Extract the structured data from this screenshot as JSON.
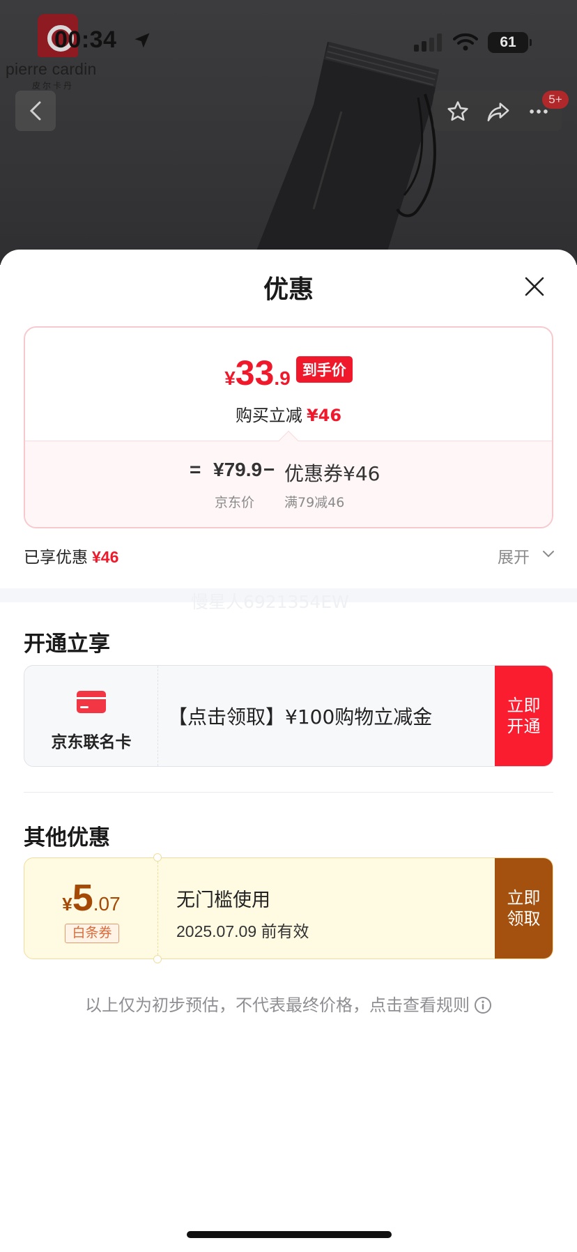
{
  "status_bar": {
    "time": "00:34",
    "battery": "61"
  },
  "brand": {
    "name": "pierre cardin",
    "subtitle": "皮尔卡丹"
  },
  "topbar": {
    "badge": "5+"
  },
  "sheet": {
    "title": "优惠",
    "price_card": {
      "currency": "¥",
      "price_int": "33",
      "price_dec": ".9",
      "price_tag": "到手价",
      "discount_label": "购买立减",
      "discount_value": "¥46",
      "eq": "=",
      "jd_price": "¥79.9",
      "minus": "−",
      "coupon": "优惠券¥46",
      "jd_price_label": "京东价",
      "coupon_rule": "满79减46"
    },
    "enjoyed_label": "已享优惠",
    "enjoyed_value": "¥46",
    "expand_label": "展开",
    "watermark": "慢星人6921354EW",
    "section_open": "开通立享",
    "jd_card": {
      "name": "京东联名卡",
      "desc": "【点击领取】¥100购物立减金",
      "cta": "立即开通"
    },
    "section_other": "其他优惠",
    "baitiao": {
      "currency": "¥",
      "amount_int": "5",
      "amount_dec": ".07",
      "tag": "白条券",
      "title": "无门槛使用",
      "validity": "2025.07.09 前有效",
      "cta": "立即领取"
    },
    "disclaimer": "以上仅为初步预估，不代表最终价格，点击查看规则"
  },
  "colors": {
    "accent_red": "#f0182b",
    "cta_red": "#fa1d30",
    "baitiao_brown": "#a4500e",
    "sheet_bg": "#ffffff"
  },
  "icons": {
    "location": "location-arrow-icon",
    "signal": "cellular-signal-icon",
    "wifi": "wifi-icon",
    "back": "chevron-left-icon",
    "favorite": "star-icon",
    "share": "share-icon",
    "more": "more-dots-icon",
    "close": "close-icon",
    "expand": "chevron-down-icon",
    "card": "credit-card-icon",
    "info": "info-icon"
  }
}
